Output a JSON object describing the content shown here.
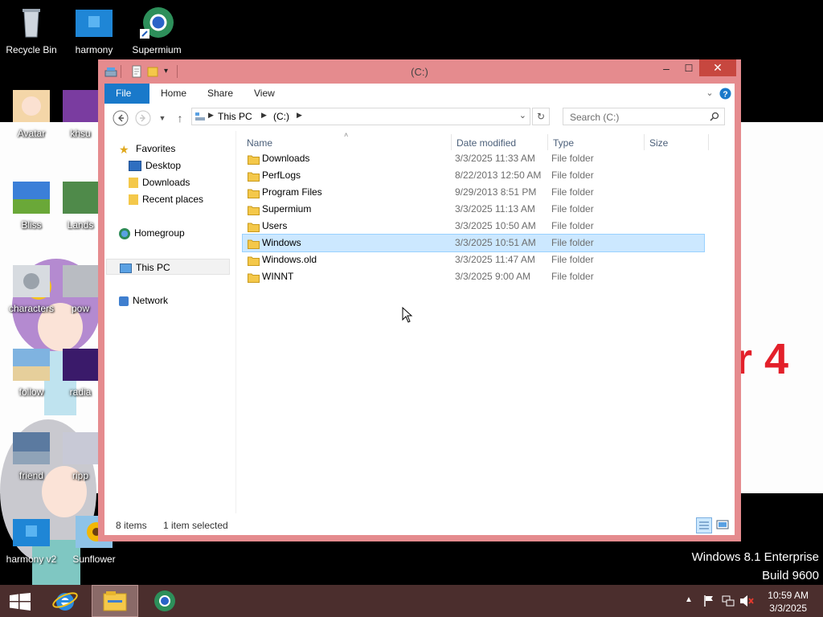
{
  "desktop": {
    "icons": [
      {
        "label": "Recycle Bin",
        "kind": "recycle-bin-icon"
      },
      {
        "label": "harmony",
        "kind": "harmony-icon"
      },
      {
        "label": "Supermium",
        "kind": "supermium-icon"
      },
      {
        "label": "Avatar",
        "kind": "avatar-image-icon"
      },
      {
        "label": "khsu",
        "kind": "khsu-image-icon"
      },
      {
        "label": "Bliss",
        "kind": "bliss-image-icon"
      },
      {
        "label": "Lands",
        "kind": "landscape-image-icon"
      },
      {
        "label": "characters",
        "kind": "characters-image-icon"
      },
      {
        "label": "pow",
        "kind": "pow-image-icon"
      },
      {
        "label": "follow",
        "kind": "follow-image-icon"
      },
      {
        "label": "radia",
        "kind": "radia-image-icon"
      },
      {
        "label": "friend",
        "kind": "friend-image-icon"
      },
      {
        "label": "ripp",
        "kind": "ripp-image-icon"
      },
      {
        "label": "harmony v2",
        "kind": "harmony-v2-icon"
      },
      {
        "label": "Sunflower",
        "kind": "sunflower-image-icon"
      }
    ],
    "wallpaper_text": "r 4",
    "watermark": {
      "line1": "Windows 8.1 Enterprise",
      "line2": "Build 9600"
    }
  },
  "explorer": {
    "title": "(C:)",
    "window_color": "#e58b8e",
    "ribbon_tabs": {
      "file": "File",
      "home": "Home",
      "share": "Share",
      "view": "View"
    },
    "address": {
      "segment1": "This PC",
      "segment2": "(C:)"
    },
    "search_placeholder": "Search  (C:)",
    "nav": {
      "favorites": "Favorites",
      "desktop": "Desktop",
      "downloads": "Downloads",
      "recent": "Recent places",
      "homegroup": "Homegroup",
      "thispc": "This PC",
      "network": "Network"
    },
    "columns": {
      "name": "Name",
      "date": "Date modified",
      "type": "Type",
      "size": "Size"
    },
    "files": [
      {
        "name": "Downloads",
        "date": "3/3/2025 11:33 AM",
        "type": "File folder"
      },
      {
        "name": "PerfLogs",
        "date": "8/22/2013 12:50 AM",
        "type": "File folder"
      },
      {
        "name": "Program Files",
        "date": "9/29/2013 8:51 PM",
        "type": "File folder"
      },
      {
        "name": "Supermium",
        "date": "3/3/2025 11:13 AM",
        "type": "File folder"
      },
      {
        "name": "Users",
        "date": "3/3/2025 10:50 AM",
        "type": "File folder"
      },
      {
        "name": "Windows",
        "date": "3/3/2025 10:51 AM",
        "type": "File folder"
      },
      {
        "name": "Windows.old",
        "date": "3/3/2025 11:47 AM",
        "type": "File folder"
      },
      {
        "name": "WINNT",
        "date": "3/3/2025 9:00 AM",
        "type": "File folder"
      }
    ],
    "selected_index": 5,
    "status": {
      "items": "8 items",
      "selected": "1 item selected"
    }
  },
  "taskbar": {
    "color": "#4b2e2d",
    "time": "10:59 AM",
    "date": "3/3/2025"
  }
}
